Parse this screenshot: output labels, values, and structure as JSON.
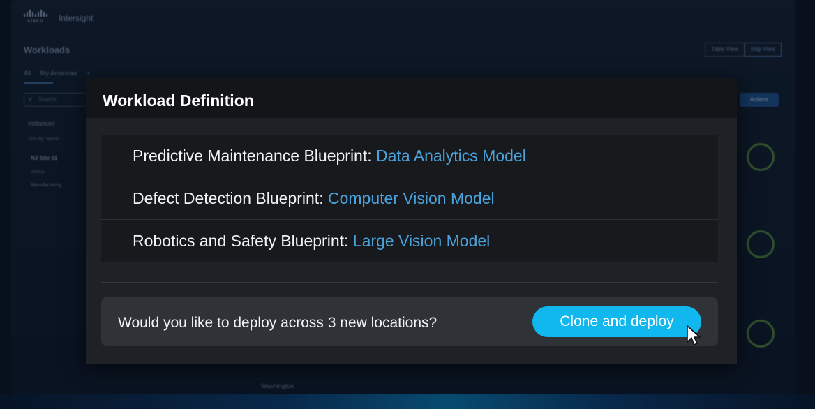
{
  "app": {
    "brand": "cisco",
    "name": "Intersight"
  },
  "page": {
    "title": "Workloads",
    "view_toggle": [
      "Table View",
      "Map View"
    ],
    "tabs": [
      "All",
      "My American",
      "+"
    ],
    "search_placeholder": "Search",
    "instances_label": "Instances",
    "sort_label": "Sort by: Name",
    "site_name": "NJ Site 01",
    "site_status": "Status",
    "site_tag": "Manufacturing",
    "actions_label": "Actions",
    "map_label": "Washington"
  },
  "modal": {
    "title": "Workload Definition",
    "definitions": [
      {
        "blueprint": "Predictive Maintenance Blueprint: ",
        "model": "Data Analytics Model"
      },
      {
        "blueprint": "Defect Detection Blueprint: ",
        "model": "Computer Vision Model"
      },
      {
        "blueprint": "Robotics and Safety Blueprint: ",
        "model": "Large Vision Model"
      }
    ],
    "prompt": "Would you like to deploy across 3 new locations?",
    "cta_label": "Clone and deploy"
  },
  "colors": {
    "accent": "#11b7ef",
    "model_text": "#4aa3dc",
    "modal_bg": "#1e2126",
    "header_bg": "#131518"
  }
}
